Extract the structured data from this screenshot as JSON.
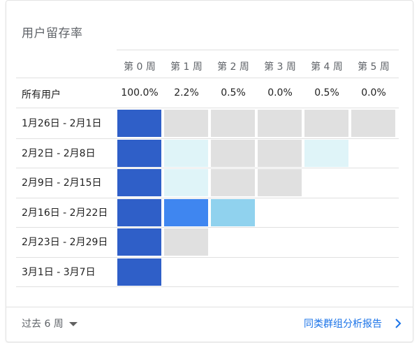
{
  "card": {
    "title": "用户留存率"
  },
  "table": {
    "columns": [
      "第 0 周",
      "第 1 周",
      "第 2 周",
      "第 3 周",
      "第 4 周",
      "第 5 周"
    ],
    "all_users_label": "所有用户",
    "all_users_values": [
      "100.0%",
      "2.2%",
      "0.5%",
      "0.0%",
      "0.5%",
      "0.0%"
    ],
    "cohorts": [
      {
        "label": "1月26日 - 2月1日",
        "cells": [
          "#2f5fc8",
          "#e0e0e0",
          "#e0e0e0",
          "#e0e0e0",
          "#e0e0e0",
          "#e0e0e0"
        ]
      },
      {
        "label": "2月2日 - 2月8日",
        "cells": [
          "#2f5fc8",
          "#dff4f8",
          "#e0e0e0",
          "#e0e0e0",
          "#dff4f8"
        ]
      },
      {
        "label": "2月9日 - 2月15日",
        "cells": [
          "#2f5fc8",
          "#dff4f8",
          "#e0e0e0",
          "#e0e0e0"
        ]
      },
      {
        "label": "2月16日 - 2月22日",
        "cells": [
          "#2f5fc8",
          "#3f86f0",
          "#90d2ee"
        ]
      },
      {
        "label": "2月23日 - 2月29日",
        "cells": [
          "#2f5fc8",
          "#e0e0e0"
        ]
      },
      {
        "label": "3月1日 - 3月7日",
        "cells": [
          "#2f5fc8"
        ]
      }
    ]
  },
  "footer": {
    "range_label": "过去 6 周",
    "range_icon": "caret-down-icon",
    "report_link": "同类群组分析报告",
    "report_icon": "chevron-right-icon"
  },
  "colors": {
    "dark_blue": "#2f5fc8",
    "blue": "#3f86f0",
    "light_blue": "#90d2ee",
    "pale_cyan": "#dff4f8",
    "gray": "#e0e0e0",
    "link": "#1a73e8"
  }
}
